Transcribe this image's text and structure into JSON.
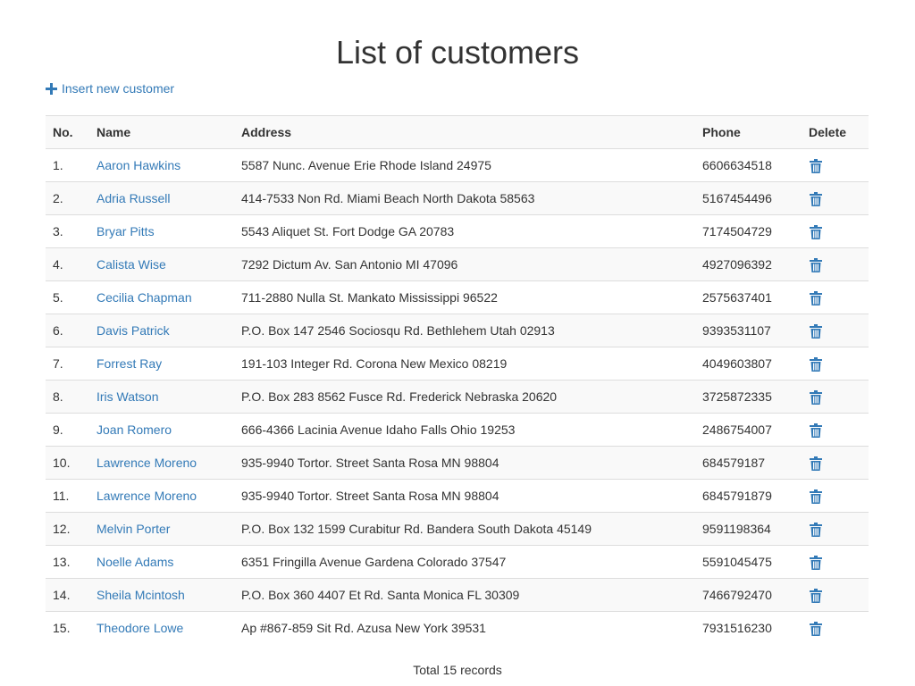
{
  "page": {
    "title": "List of customers",
    "insert_label": "Insert new customer",
    "total_text": "Total 15 records"
  },
  "colors": {
    "link": "#337ab7",
    "text": "#333333",
    "border": "#dddddd",
    "stripe": "#f9f9f9"
  },
  "table": {
    "headers": {
      "no": "No.",
      "name": "Name",
      "address": "Address",
      "phone": "Phone",
      "delete": "Delete"
    },
    "rows": [
      {
        "no": "1.",
        "name": "Aaron Hawkins",
        "address": "5587 Nunc. Avenue Erie Rhode Island 24975",
        "phone": "6606634518"
      },
      {
        "no": "2.",
        "name": "Adria Russell",
        "address": "414-7533 Non Rd. Miami Beach North Dakota 58563",
        "phone": "5167454496"
      },
      {
        "no": "3.",
        "name": "Bryar Pitts",
        "address": "5543 Aliquet St. Fort Dodge GA 20783",
        "phone": "7174504729"
      },
      {
        "no": "4.",
        "name": "Calista Wise",
        "address": "7292 Dictum Av. San Antonio MI 47096",
        "phone": "4927096392"
      },
      {
        "no": "5.",
        "name": "Cecilia Chapman",
        "address": "711-2880 Nulla St. Mankato Mississippi 96522",
        "phone": "2575637401"
      },
      {
        "no": "6.",
        "name": "Davis Patrick",
        "address": "P.O. Box 147 2546 Sociosqu Rd. Bethlehem Utah 02913",
        "phone": "9393531107"
      },
      {
        "no": "7.",
        "name": "Forrest Ray",
        "address": "191-103 Integer Rd. Corona New Mexico 08219",
        "phone": "4049603807"
      },
      {
        "no": "8.",
        "name": "Iris Watson",
        "address": "P.O. Box 283 8562 Fusce Rd. Frederick Nebraska 20620",
        "phone": "3725872335"
      },
      {
        "no": "9.",
        "name": "Joan Romero",
        "address": "666-4366 Lacinia Avenue Idaho Falls Ohio 19253",
        "phone": "2486754007"
      },
      {
        "no": "10.",
        "name": "Lawrence Moreno",
        "address": "935-9940 Tortor. Street Santa Rosa MN 98804",
        "phone": "684579187"
      },
      {
        "no": "11.",
        "name": "Lawrence Moreno",
        "address": "935-9940 Tortor. Street Santa Rosa MN 98804",
        "phone": "6845791879"
      },
      {
        "no": "12.",
        "name": "Melvin Porter",
        "address": "P.O. Box 132 1599 Curabitur Rd. Bandera South Dakota 45149",
        "phone": "9591198364"
      },
      {
        "no": "13.",
        "name": "Noelle Adams",
        "address": "6351 Fringilla Avenue Gardena Colorado 37547",
        "phone": "5591045475"
      },
      {
        "no": "14.",
        "name": "Sheila Mcintosh",
        "address": "P.O. Box 360 4407 Et Rd. Santa Monica FL 30309",
        "phone": "7466792470"
      },
      {
        "no": "15.",
        "name": "Theodore Lowe",
        "address": "Ap #867-859 Sit Rd. Azusa New York 39531",
        "phone": "7931516230"
      }
    ]
  },
  "icons": {
    "insert": "plus-icon",
    "delete": "trash-icon"
  }
}
